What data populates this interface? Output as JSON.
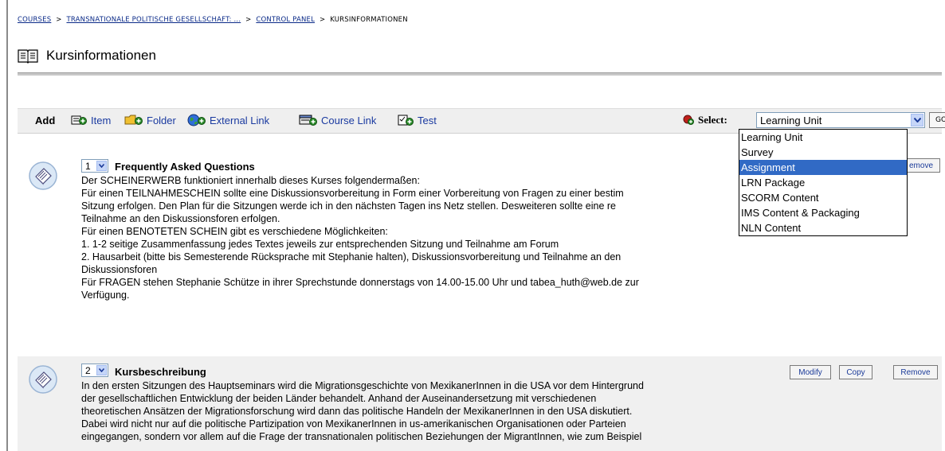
{
  "breadcrumb": {
    "courses": "COURSES",
    "course": "TRANSNATIONALE POLITISCHE GESELLSCHAFT: ...",
    "control_panel": "CONTROL PANEL",
    "current": "KURSINFORMATIONEN",
    "separator": ">"
  },
  "page_title": "Kursinformationen",
  "toolbar": {
    "add_label": "Add",
    "item_label": "Item",
    "folder_label": "Folder",
    "external_link_label": "External Link",
    "course_link_label": "Course Link",
    "test_label": "Test",
    "select_label": "Select:",
    "select_value": "Learning Unit",
    "go_label": "GO"
  },
  "dropdown": {
    "options": [
      "Learning Unit",
      "Survey",
      "Assignment",
      "LRN Package",
      "SCORM Content",
      "IMS Content & Packaging",
      "NLN Content"
    ],
    "highlighted": "Assignment"
  },
  "items": [
    {
      "position": "1",
      "title": "Frequently Asked Questions",
      "lines": [
        "Der SCHEINERWERB funktioniert innerhalb dieses Kurses folgendermaßen:",
        "Für einen TEILNAHMESCHEIN sollte eine Diskussionsvorbereitung in Form einer Vorbereitung von Fragen zu einer bestim",
        "Sitzung erfolgen. Den Plan für die Sitzungen werde ich in den nächsten Tagen ins Netz stellen. Desweiteren sollte eine re",
        "Teilnahme an den Diskussionsforen erfolgen.",
        "Für einen BENOTETEN SCHEIN gibt es verschiedene Möglichkeiten:",
        "1. 1-2 seitige Zusammenfassung jedes Textes jeweils zur entsprechenden Sitzung und Teilnahme am Forum",
        "2. Hausarbeit (bitte bis Semesterende Rücksprache mit Stephanie halten), Diskussionsvorbereitung und Teilnahme an den",
        "Diskussionsforen",
        "Für FRAGEN stehen Stephanie Schütze in ihrer Sprechstunde donnerstags von 14.00-15.00 Uhr und tabea_huth@web.de zur",
        "Verfügung."
      ],
      "remove_label": "emove"
    },
    {
      "position": "2",
      "title": "Kursbeschreibung",
      "lines": [
        "In den ersten Sitzungen des Hauptseminars wird die Migrationsgeschichte von MexikanerInnen in die USA vor dem Hintergrund",
        "der gesellschaftlichen Entwicklung der beiden Länder behandelt. Anhand der Auseinandersetzung mit verschiedenen",
        "theoretischen Ansätzen der Migrationsforschung wird dann das politische Handeln der MexikanerInnen in den USA diskutiert.",
        "Dabei wird nicht nur auf die politische Partizipation von MexikanerInnen in us-amerikanischen Organisationen oder Parteien",
        "eingegangen, sondern vor allem auf die Frage der transnationalen politischen Beziehungen der MigrantInnen, wie zum Beispiel"
      ],
      "modify_label": "Modify",
      "copy_label": "Copy",
      "remove_label": "Remove"
    }
  ],
  "colors": {
    "link": "#0a2a88",
    "highlight": "#316ac5",
    "toolbar_bg": "#efefef",
    "item2_bg": "#f0f0f0"
  }
}
